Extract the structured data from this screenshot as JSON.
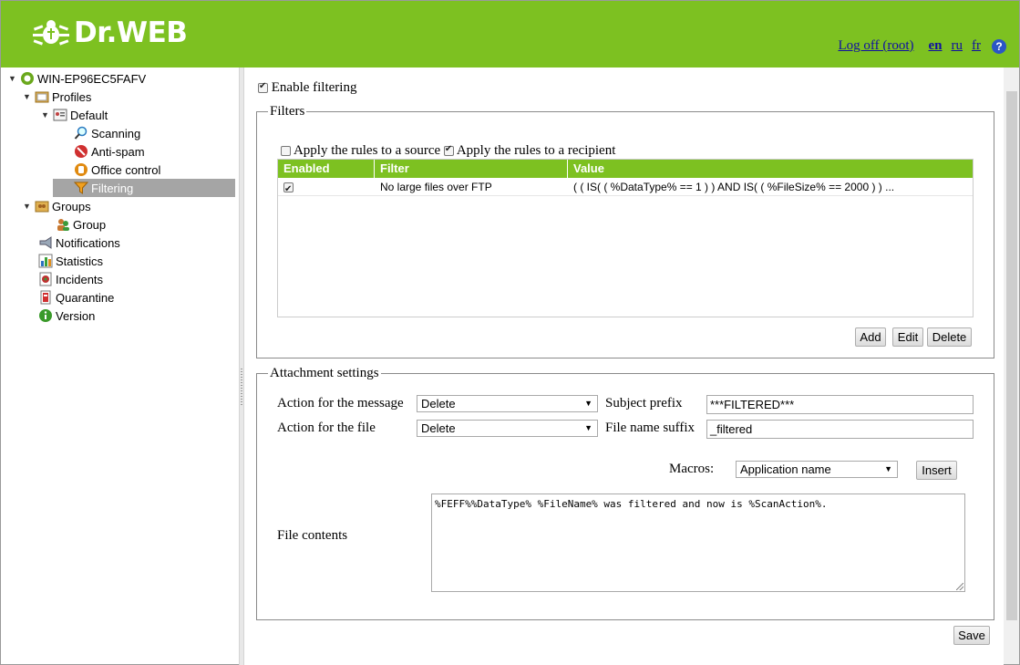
{
  "header": {
    "logo_text": "Dr.WEB",
    "logoff_label": "Log off (root)",
    "languages": [
      "en",
      "ru",
      "fr"
    ],
    "active_language": "en",
    "help_label": "?",
    "brand_color": "#7dc121"
  },
  "tree": {
    "root": "WIN-EP96EC5FAFV",
    "profiles": "Profiles",
    "default": "Default",
    "scanning": "Scanning",
    "antispam": "Anti-spam",
    "office_control": "Office control",
    "filtering": "Filtering",
    "groups": "Groups",
    "group": "Group",
    "notifications": "Notifications",
    "statistics": "Statistics",
    "incidents": "Incidents",
    "quarantine": "Quarantine",
    "version": "Version",
    "selected": "Filtering"
  },
  "main": {
    "enable_filtering_label": "Enable filtering",
    "enable_filtering_checked": true,
    "filters_legend": "Filters",
    "apply_source_label": "Apply the rules to a source",
    "apply_source_checked": false,
    "apply_recipient_label": "Apply the rules to a recipient",
    "apply_recipient_checked": true,
    "grid": {
      "columns": [
        "Enabled",
        "Filter",
        "Value"
      ],
      "rows": [
        {
          "enabled": true,
          "filter": "No large files over FTP",
          "value": "( ( IS( ( %DataType% == 1 ) ) AND IS( ( %FileSize% == 2000 ) ) ..."
        }
      ]
    },
    "add_label": "Add",
    "edit_label": "Edit",
    "delete_label": "Delete",
    "attachment_legend": "Attachment settings",
    "action_message_label": "Action for the message",
    "action_message_value": "Delete",
    "subject_prefix_label": "Subject prefix",
    "subject_prefix_value": "***FILTERED***",
    "action_file_label": "Action for the file",
    "action_file_value": "Delete",
    "file_suffix_label": "File name suffix",
    "file_suffix_value": "_filtered",
    "macros_label": "Macros:",
    "macros_value": "Application name",
    "insert_label": "Insert",
    "file_contents_label": "File contents",
    "file_contents_value": "%FEFF%%DataType% %FileName% was filtered and now is %ScanAction%.",
    "save_label": "Save"
  }
}
